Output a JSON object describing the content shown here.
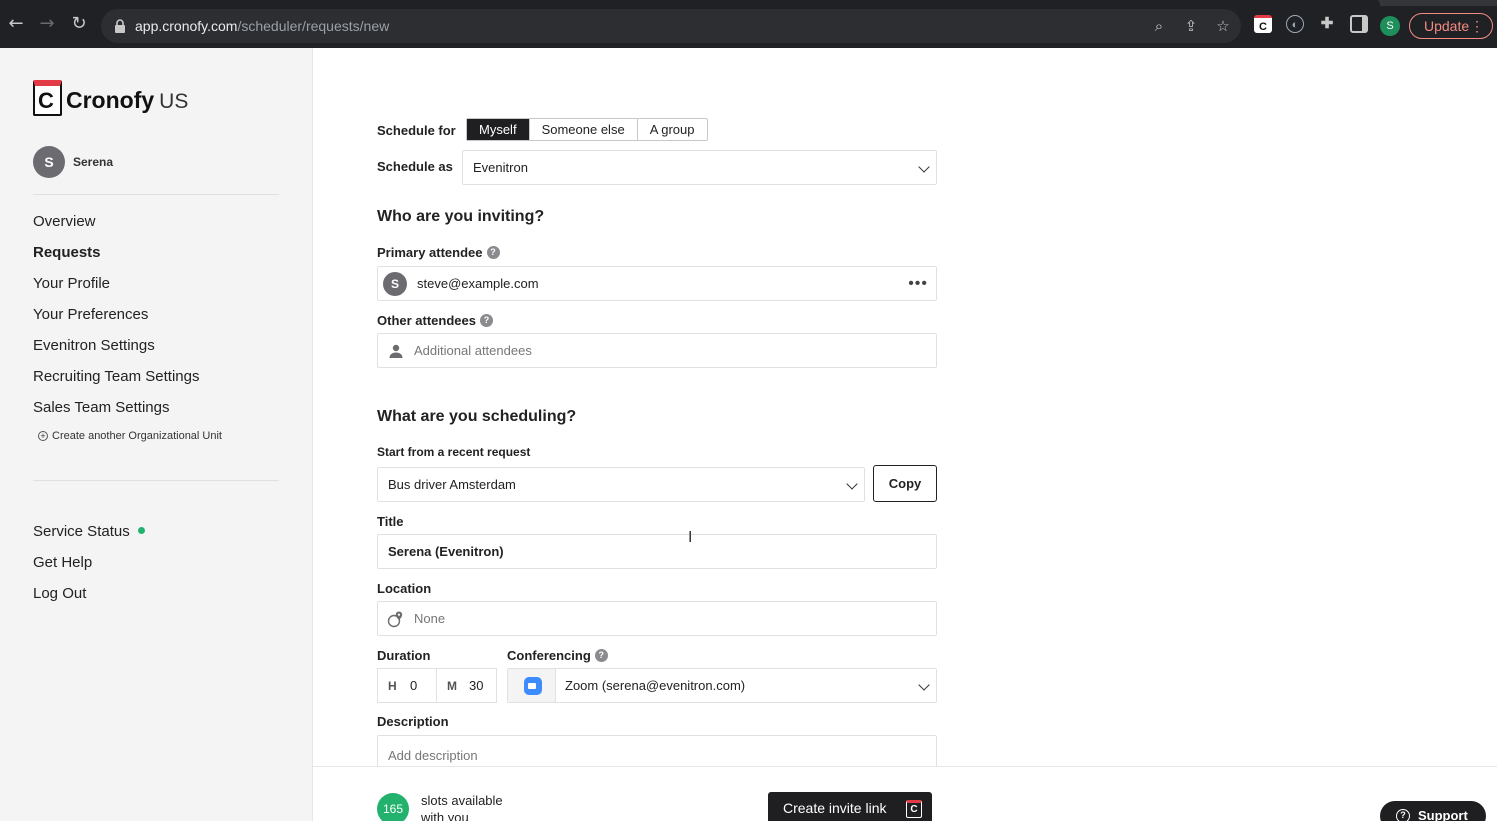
{
  "browser": {
    "url_host": "app.cronofy.com",
    "url_path": "/scheduler/requests/new",
    "update_label": "Update",
    "profile_initial": "S"
  },
  "sidebar": {
    "brand": "Cronofy",
    "region": "US",
    "logo_letter": "C",
    "user": {
      "initial": "S",
      "name": "Serena"
    },
    "nav": [
      {
        "label": "Overview",
        "active": false
      },
      {
        "label": "Requests",
        "active": true
      },
      {
        "label": "Your Profile",
        "active": false
      },
      {
        "label": "Your Preferences",
        "active": false
      },
      {
        "label": "Evenitron Settings",
        "active": false
      },
      {
        "label": "Recruiting Team Settings",
        "active": false
      },
      {
        "label": "Sales Team Settings",
        "active": false
      }
    ],
    "create_unit": "Create another Organizational Unit",
    "footer_nav": [
      {
        "label": "Service Status"
      },
      {
        "label": "Get Help"
      },
      {
        "label": "Log Out"
      }
    ],
    "status_color": "#23b26d"
  },
  "form": {
    "schedule_for": {
      "label": "Schedule for",
      "options": [
        "Myself",
        "Someone else",
        "A group"
      ],
      "selected": "Myself"
    },
    "schedule_as": {
      "label": "Schedule as",
      "value": "Evenitron"
    },
    "inviting_heading": "Who are you inviting?",
    "primary_attendee": {
      "label": "Primary attendee",
      "initial": "S",
      "value": "steve@example.com"
    },
    "other_attendees": {
      "label": "Other attendees",
      "placeholder": "Additional attendees"
    },
    "scheduling_heading": "What are you scheduling?",
    "recent_request": {
      "label": "Start from a recent request",
      "value": "Bus driver Amsterdam",
      "copy_label": "Copy"
    },
    "title": {
      "label": "Title",
      "value": "Serena (Evenitron)"
    },
    "location": {
      "label": "Location",
      "placeholder": "None"
    },
    "duration": {
      "label": "Duration",
      "hours_key": "H",
      "hours": "0",
      "minutes_key": "M",
      "minutes": "30"
    },
    "conferencing": {
      "label": "Conferencing",
      "value": "Zoom (serena@evenitron.com)"
    },
    "description": {
      "label": "Description",
      "placeholder": "Add description"
    }
  },
  "bottom_bar": {
    "slots_count": "165",
    "slots_line1": "slots available",
    "slots_line2": "with you",
    "invite_label": "Create invite link",
    "support_label": "Support"
  },
  "colors": {
    "accent_dark": "#1f1f22",
    "brand_red": "#e23b46",
    "success_green": "#23b26d",
    "zoom_blue": "#3d8bfd"
  }
}
